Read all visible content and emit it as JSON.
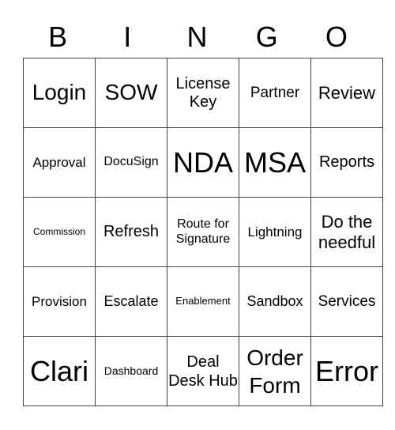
{
  "header": {
    "letters": [
      "B",
      "I",
      "N",
      "G",
      "O"
    ]
  },
  "grid": {
    "rows": [
      [
        "Login",
        "SOW",
        "License Key",
        "Partner",
        "Review"
      ],
      [
        "Approval",
        "DocuSign",
        "NDA",
        "MSA",
        "Reports"
      ],
      [
        "Commission",
        "Refresh",
        "Route for Signature",
        "Lightning",
        "Do the needful"
      ],
      [
        "Provision",
        "Escalate",
        "Enablement",
        "Sandbox",
        "Services"
      ],
      [
        "Clari",
        "Dashboard",
        "Deal Desk Hub",
        "Order Form",
        "Error"
      ]
    ]
  }
}
